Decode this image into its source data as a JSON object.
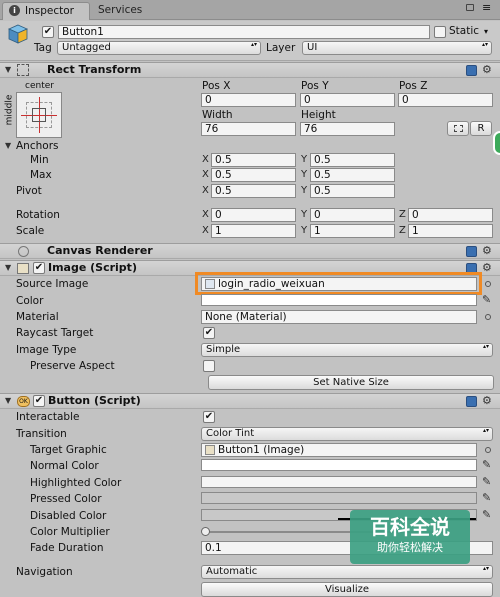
{
  "tabs": [
    {
      "label": "Inspector"
    },
    {
      "label": "Services"
    }
  ],
  "object": {
    "name": "Button1",
    "static_label": "Static",
    "tag_label": "Tag",
    "tag": "Untagged",
    "layer_label": "Layer",
    "layer": "UI"
  },
  "rect": {
    "title": "Rect Transform",
    "anchor_h": "center",
    "anchor_v": "middle",
    "posx_label": "Pos X",
    "posy_label": "Pos Y",
    "posz_label": "Pos Z",
    "posx": "0",
    "posy": "0",
    "posz": "0",
    "width_label": "Width",
    "height_label": "Height",
    "width": "76",
    "height": "76",
    "r_button": "R",
    "anchors_label": "Anchors",
    "min_label": "Min",
    "max_label": "Max",
    "min_x": "0.5",
    "min_y": "0.5",
    "max_x": "0.5",
    "max_y": "0.5",
    "pivot_label": "Pivot",
    "pivot_x": "0.5",
    "pivot_y": "0.5",
    "rotation_label": "Rotation",
    "rot_x": "0",
    "rot_y": "0",
    "rot_z": "0",
    "scale_label": "Scale",
    "scale_x": "1",
    "scale_y": "1",
    "scale_z": "1",
    "x": "X",
    "y": "Y",
    "z": "Z"
  },
  "canvas_renderer": {
    "title": "Canvas Renderer"
  },
  "image": {
    "title": "Image (Script)",
    "source_label": "Source Image",
    "source_value": "login_radio_weixuan",
    "color_label": "Color",
    "material_label": "Material",
    "material_value": "None (Material)",
    "raycast_label": "Raycast Target",
    "type_label": "Image Type",
    "type_value": "Simple",
    "preserve_label": "Preserve Aspect",
    "native_button": "Set Native Size",
    "highlight_color": "#f08a24"
  },
  "button": {
    "title": "Button (Script)",
    "interactable_label": "Interactable",
    "transition_label": "Transition",
    "transition_value": "Color Tint",
    "target_label": "Target Graphic",
    "target_value": "Button1 (Image)",
    "normal_label": "Normal Color",
    "highlighted_label": "Highlighted Color",
    "pressed_label": "Pressed Color",
    "disabled_label": "Disabled Color",
    "multiplier_label": "Color Multiplier",
    "fade_label": "Fade Duration",
    "fade_value": "0.1",
    "navigation_label": "Navigation",
    "navigation_value": "Automatic",
    "visualize_label": "Visualize"
  },
  "watermark": {
    "title": "百科全说",
    "subtitle": "助你轻松解决"
  }
}
